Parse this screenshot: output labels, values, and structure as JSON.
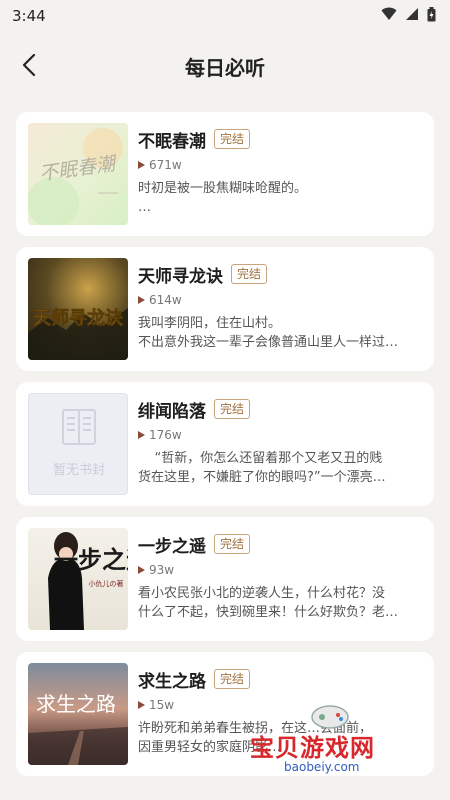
{
  "status": {
    "time": "3:44"
  },
  "header": {
    "title": "每日必听"
  },
  "books": [
    {
      "title": "不眠春潮",
      "badge": "完结",
      "plays": "671w",
      "desc_lines": [
        "时初是被一股焦糊味呛醒的。",
        "…"
      ],
      "cover_text": "不眠春潮",
      "cover_style": "pastel"
    },
    {
      "title": "天师寻龙诀",
      "badge": "完结",
      "plays": "614w",
      "desc_lines": [
        "我叫李阴阳，住在山村。",
        "不出意外我这一辈子会像普通山里人一样过…"
      ],
      "cover_text": "天师寻龙诀",
      "cover_style": "golden"
    },
    {
      "title": "绯闻陷落",
      "badge": "完结",
      "plays": "176w",
      "desc_lines": [
        "    “哲新，你怎么还留着那个又老又丑的贱",
        "货在这里，不嫌脏了你的眼吗?”一个漂亮…"
      ],
      "cover_text": "暂无书封",
      "cover_style": "placeholder"
    },
    {
      "title": "一步之遥",
      "badge": "完结",
      "plays": "93w",
      "desc_lines": [
        "看小农民张小北的逆袭人生，什么村花？没",
        "什么了不起，快到碗里来！什么好欺负？老…"
      ],
      "cover_text": "一步之遥",
      "cover_author": "小仇儿の著",
      "cover_style": "portrait"
    },
    {
      "title": "求生之路",
      "badge": "完结",
      "plays": "15w",
      "desc_lines": [
        "许盼死和弟弟春生被拐，在这…会面前，",
        "因重男轻女的家庭阴影…"
      ],
      "cover_text": "求生之路",
      "cover_style": "sunset"
    }
  ],
  "watermark": {
    "text": "宝贝游戏网",
    "url": "baobeiy.com"
  }
}
